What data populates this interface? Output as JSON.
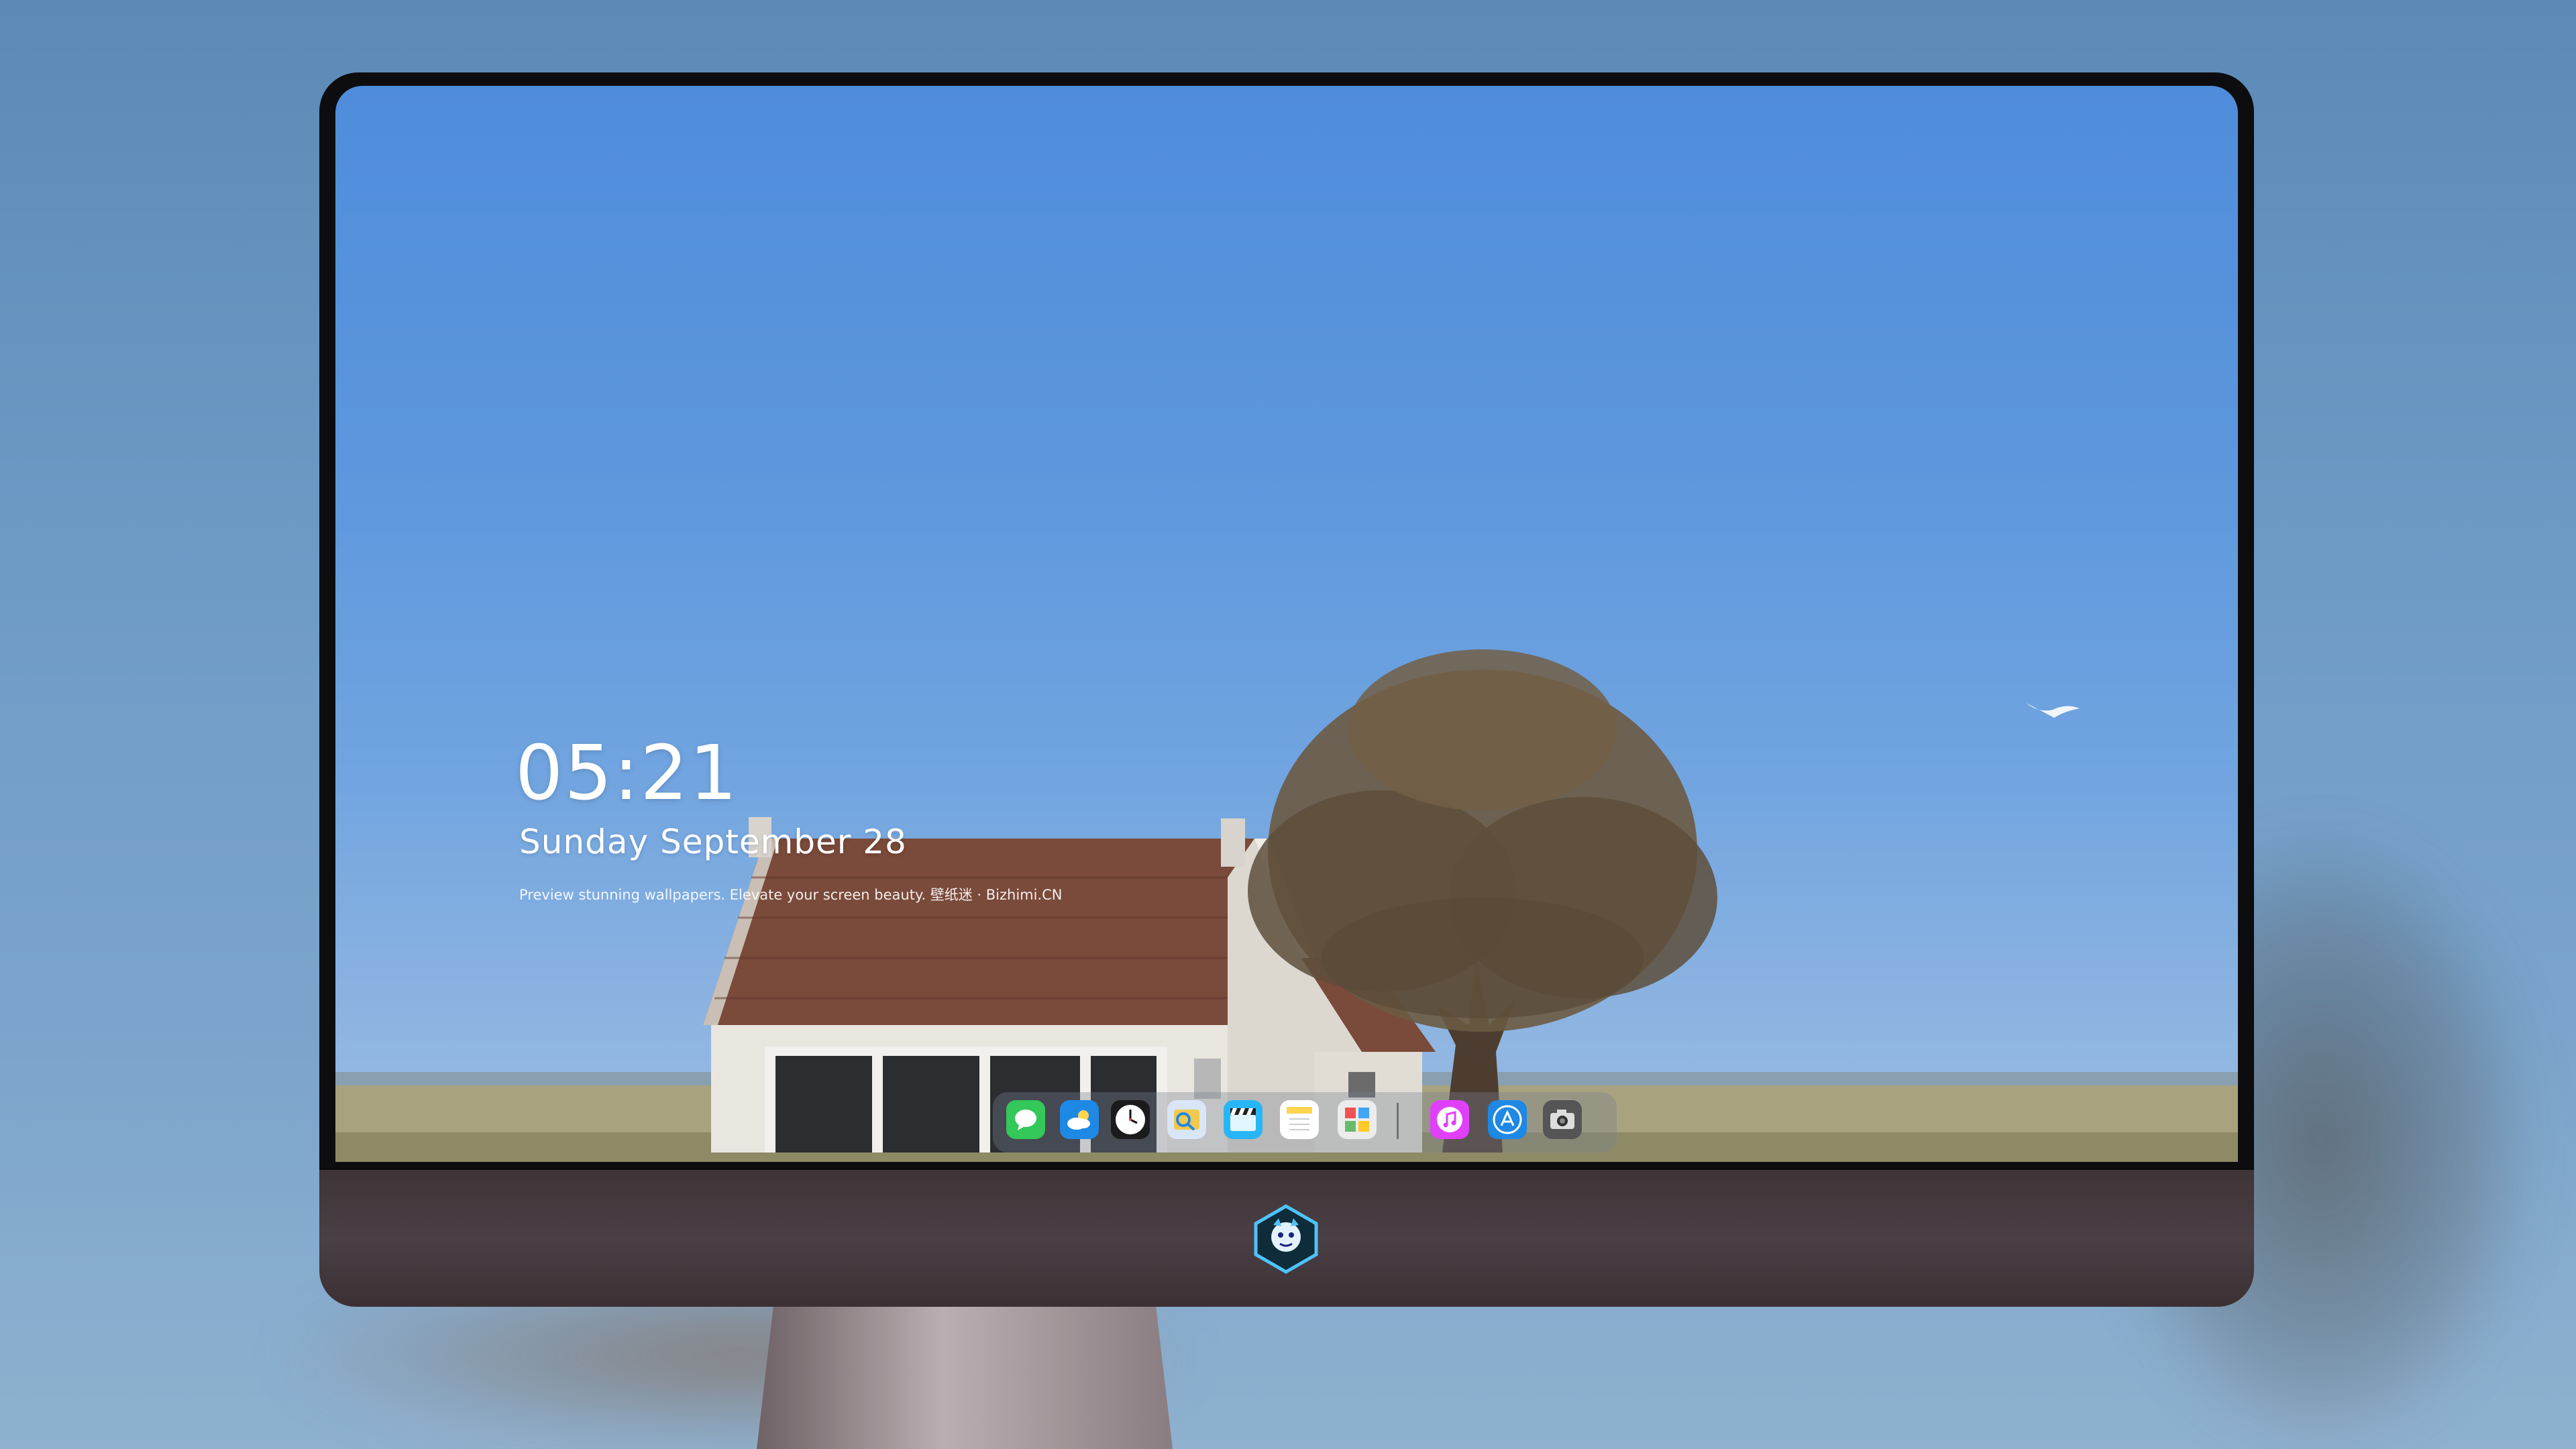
{
  "wallpaper_overlay": {
    "time": "05:21",
    "date": "Sunday September  28",
    "tagline": "Preview stunning wallpapers. Elevate your screen beauty. 壁纸迷 · Bizhimi.CN"
  },
  "dock": {
    "apps": [
      {
        "name": "messages",
        "icon": "message-bubble-icon",
        "color": "#34c759"
      },
      {
        "name": "weather",
        "icon": "cloud-sun-icon",
        "color": "#1e88e5"
      },
      {
        "name": "clock",
        "icon": "clock-icon",
        "color": "#ffffff"
      },
      {
        "name": "preview",
        "icon": "preview-icon",
        "color": "#f2c94c"
      },
      {
        "name": "clips",
        "icon": "clapperboard-icon",
        "color": "#29b6f6"
      },
      {
        "name": "notes",
        "icon": "notes-icon",
        "color": "#ffd54f"
      },
      {
        "name": "photos-grid",
        "icon": "grid-photos-icon",
        "color": "#e0e0e0"
      },
      {
        "name": "music",
        "icon": "music-note-icon",
        "color": "#e040fb"
      },
      {
        "name": "app-store",
        "icon": "app-store-icon",
        "color": "#1e88e5"
      },
      {
        "name": "camera",
        "icon": "camera-icon",
        "color": "#555555"
      }
    ]
  },
  "colors": {
    "sky_top": "#4f8cdb",
    "sky_bottom": "#9dbde2",
    "bezel": "#0d0d0f",
    "chin": "#4a3f44"
  }
}
